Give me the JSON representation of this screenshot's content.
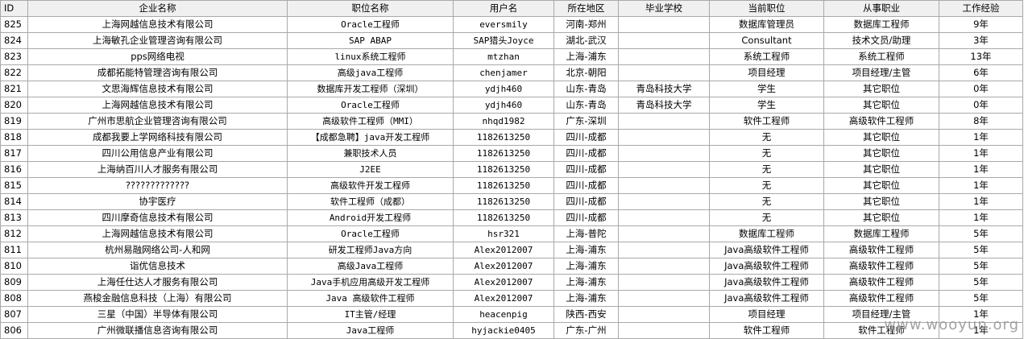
{
  "headers": [
    "ID",
    "企业名称",
    "职位名称",
    "用户名",
    "所在地区",
    "毕业学校",
    "当前职位",
    "从事职业",
    "工作经验"
  ],
  "rows": [
    [
      "825",
      "上海网越信息技术有限公司",
      "Oracle工程师",
      "eversmily",
      "河南-郑州",
      "",
      "数据库管理员",
      "数据库工程师",
      "9年"
    ],
    [
      "824",
      "上海敏孔企业管理咨询有限公司",
      "SAP ABAP",
      "SAP猎头Joyce",
      "湖北-武汉",
      "",
      "Consultant",
      "技术文员/助理",
      "3年"
    ],
    [
      "823",
      "pps网络电视",
      "linux系统工程师",
      "mtzhan",
      "上海-浦东",
      "",
      "系统工程师",
      "系统工程师",
      "13年"
    ],
    [
      "822",
      "成都拓能特管理咨询有限公司",
      "高级java工程师",
      "chenjamer",
      "北京-朝阳",
      "",
      "项目经理",
      "项目经理/主管",
      "6年"
    ],
    [
      "821",
      "文思海辉信息技术有限公司",
      "数据库开发工程师（深圳）",
      "ydjh460",
      "山东-青岛",
      "青岛科技大学",
      "学生",
      "其它职位",
      "0年"
    ],
    [
      "820",
      "上海网越信息技术有限公司",
      "Oracle工程师",
      "ydjh460",
      "山东-青岛",
      "青岛科技大学",
      "学生",
      "其它职位",
      "0年"
    ],
    [
      "819",
      "广州市思航企业管理咨询有限公司",
      "高级软件工程师（MMI）",
      "nhqd1982",
      "广东-深圳",
      "",
      "软件工程师",
      "高级软件工程师",
      "8年"
    ],
    [
      "818",
      "成都我要上学网络科技有限公司",
      "【成都急聘】java开发工程师",
      "1182613250",
      "四川-成都",
      "",
      "无",
      "其它职位",
      "1年"
    ],
    [
      "817",
      "四川公用信息产业有限公司",
      "兼职技术人员",
      "1182613250",
      "四川-成都",
      "",
      "无",
      "其它职位",
      "1年"
    ],
    [
      "816",
      "上海纳百川人才服务有限公司",
      "J2EE",
      "1182613250",
      "四川-成都",
      "",
      "无",
      "其它职位",
      "1年"
    ],
    [
      "815",
      "?????????????",
      "高级软件开发工程师",
      "1182613250",
      "四川-成都",
      "",
      "无",
      "其它职位",
      "1年"
    ],
    [
      "814",
      "协宇医疗",
      "软件工程师（成都）",
      "1182613250",
      "四川-成都",
      "",
      "无",
      "其它职位",
      "1年"
    ],
    [
      "813",
      "四川摩奇信息技术有限公司",
      "Android开发工程师",
      "1182613250",
      "四川-成都",
      "",
      "无",
      "其它职位",
      "1年"
    ],
    [
      "812",
      "上海网越信息技术有限公司",
      "Oracle工程师",
      "hsr321",
      "上海-普陀",
      "",
      "数据库工程师",
      "数据库工程师",
      "5年"
    ],
    [
      "811",
      "杭州易融网络公司-人和网",
      "研发工程师Java方向",
      "Alex2012007",
      "上海-浦东",
      "",
      "Java高级软件工程师",
      "高级软件工程师",
      "5年"
    ],
    [
      "810",
      "诣优信息技术",
      "高级Java工程师",
      "Alex2012007",
      "上海-浦东",
      "",
      "Java高级软件工程师",
      "高级软件工程师",
      "5年"
    ],
    [
      "809",
      "上海任仕达人才服务有限公司",
      "Java手机应用高级开发工程师",
      "Alex2012007",
      "上海-浦东",
      "",
      "Java高级软件工程师",
      "高级软件工程师",
      "5年"
    ],
    [
      "808",
      "燕梭金融信息科技（上海）有限公司",
      "Java 高级软件工程师",
      "Alex2012007",
      "上海-浦东",
      "",
      "Java高级软件工程师",
      "高级软件工程师",
      "5年"
    ],
    [
      "807",
      "三星（中国）半导体有限公司",
      "IT主管/经理",
      "heacenpig",
      "陕西-西安",
      "",
      "项目经理",
      "项目经理/主管",
      "1年"
    ],
    [
      "806",
      "广州微联播信息咨询有限公司",
      "Java工程师",
      "hyjackie0405",
      "广东-广州",
      "",
      "软件工程师",
      "软件工程师",
      "1年"
    ]
  ],
  "watermark": "www.wooyun.org"
}
